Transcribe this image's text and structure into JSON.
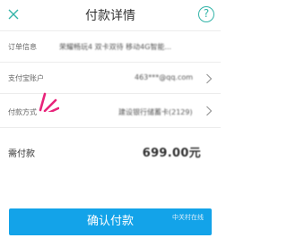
{
  "header": {
    "title": "付款详情",
    "close_icon": "close-icon",
    "help_symbol": "?",
    "accent_color": "#32b4a8"
  },
  "rows": {
    "order": {
      "label": "订单信息",
      "value": "荣耀畅玩4 双卡双待 移动4G智能..."
    },
    "account": {
      "label": "支付宝账户",
      "value": "463***@qq.com"
    },
    "method": {
      "label": "付款方式",
      "value": "建设银行储蓄卡(2129)"
    }
  },
  "payment": {
    "label": "需付款",
    "amount": "699.00元"
  },
  "confirm": {
    "label": "确认付款",
    "color": "#13a3e9"
  },
  "watermark": "中关村在线"
}
